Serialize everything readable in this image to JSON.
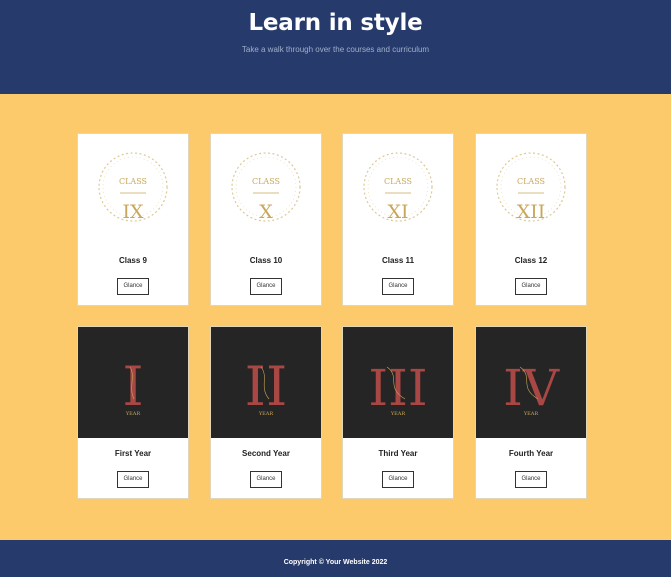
{
  "header": {
    "title": "Learn in style",
    "subtitle": "Take a walk through over the courses and curriculum"
  },
  "row1": [
    {
      "caption": "CLASS",
      "numeral": "IX",
      "title": "Class 9",
      "button": "Glance"
    },
    {
      "caption": "CLASS",
      "numeral": "X",
      "title": "Class 10",
      "button": "Glance"
    },
    {
      "caption": "CLASS",
      "numeral": "XI",
      "title": "Class 11",
      "button": "Glance"
    },
    {
      "caption": "CLASS",
      "numeral": "XII",
      "title": "Class 12",
      "button": "Glance"
    }
  ],
  "row2": [
    {
      "numeral": "I",
      "caption": "YEAR",
      "title": "First Year",
      "button": "Glance"
    },
    {
      "numeral": "II",
      "caption": "YEAR",
      "title": "Second Year",
      "button": "Glance"
    },
    {
      "numeral": "III",
      "caption": "YEAR",
      "title": "Third Year",
      "button": "Glance"
    },
    {
      "numeral": "IV",
      "caption": "YEAR",
      "title": "Fourth Year",
      "button": "Glance"
    }
  ],
  "footer": {
    "copyright": "Copyright © Your Website 2022"
  },
  "colors": {
    "header_bg": "#263a6b",
    "page_bg": "#fcc96b",
    "gold": "#c9a75a",
    "crimson": "#a84743",
    "dark_card": "#252525"
  }
}
